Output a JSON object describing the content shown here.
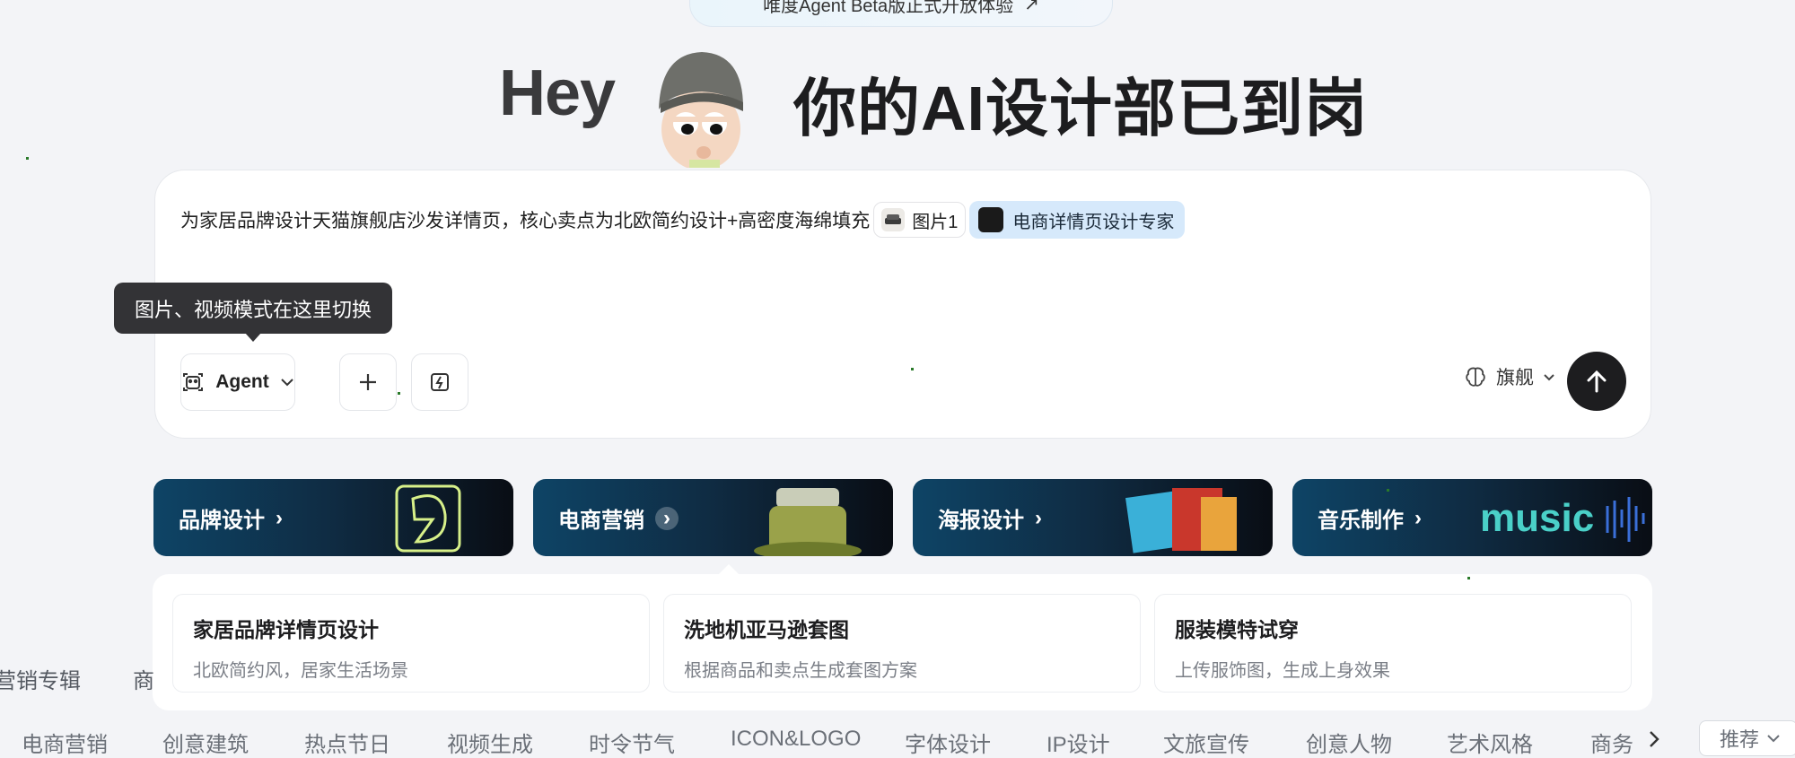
{
  "announcement": {
    "text": "唯度Agent Beta版正式开放体验",
    "arrow": "↗"
  },
  "hero": {
    "greeting": "Hey",
    "title": "你的AI设计部已到岗"
  },
  "composer": {
    "prompt_text": "为家居品牌设计天猫旗舰店沙发详情页，核心卖点为北欧简约设计+高密度海绵填充",
    "image_chip_label": "图片1",
    "agent_chip_label": "电商详情页设计专家",
    "tooltip": "图片、视频模式在这里切换",
    "mode_label": "Agent",
    "model_label": "旗舰"
  },
  "categories": [
    {
      "label": "品牌设计"
    },
    {
      "label": "电商营销"
    },
    {
      "label": "海报设计"
    },
    {
      "label": "音乐制作"
    }
  ],
  "category_art": {
    "music_word": "music"
  },
  "suggestions": [
    {
      "title": "家居品牌详情页设计",
      "subtitle": "北欧简约风，居家生活场景"
    },
    {
      "title": "洗地机亚马逊套图",
      "subtitle": "根据商品和卖点生成套图方案"
    },
    {
      "title": "服装模特试穿",
      "subtitle": "上传服饰图，生成上身效果"
    }
  ],
  "side_labels": [
    "营销专辑",
    "商"
  ],
  "tabs": [
    "电商营销",
    "创意建筑",
    "热点节日",
    "视频生成",
    "时令节气",
    "ICON&LOGO",
    "字体设计",
    "IP设计",
    "文旅宣传",
    "创意人物",
    "艺术风格",
    "商务"
  ],
  "sort_label": "推荐",
  "colors": {
    "background": "#f3f4f7",
    "send_button": "#1d1d1f",
    "agent_chip": "#d6e9fb",
    "tooltip": "#333336"
  }
}
